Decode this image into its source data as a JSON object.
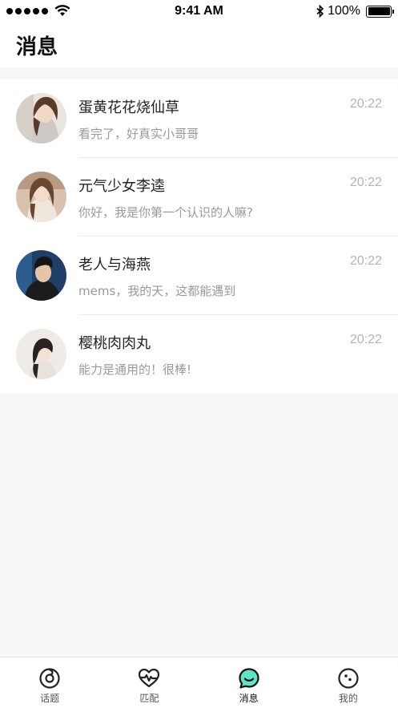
{
  "status_bar": {
    "time": "9:41 AM",
    "battery": "100%"
  },
  "header": {
    "title": "消息"
  },
  "messages": [
    {
      "name": "蛋黄花花烧仙草",
      "time": "20:22",
      "preview": "看完了，好真实小哥哥",
      "avatar": "woman-avatar-1"
    },
    {
      "name": "元气少女李逵",
      "time": "20:22",
      "preview": "你好，我是你第一个认识的人嘛?",
      "avatar": "woman-avatar-2"
    },
    {
      "name": "老人与海燕",
      "time": "20:22",
      "preview": "mems，我的天，这都能遇到",
      "avatar": "man-avatar"
    },
    {
      "name": "樱桃肉肉丸",
      "time": "20:22",
      "preview": "能力是通用的！很棒!",
      "avatar": "woman-avatar-3"
    }
  ],
  "tabs": [
    {
      "label": "话题",
      "icon": "topic-icon"
    },
    {
      "label": "匹配",
      "icon": "heartbeat-icon"
    },
    {
      "label": "消息",
      "icon": "chat-bubble-icon",
      "active": true
    },
    {
      "label": "我的",
      "icon": "profile-face-icon"
    }
  ],
  "colors": {
    "accent": "#5de6c5",
    "background": "#f6f7f7",
    "time_text": "#b3b3b3",
    "preview_text": "#9a9a9a"
  }
}
